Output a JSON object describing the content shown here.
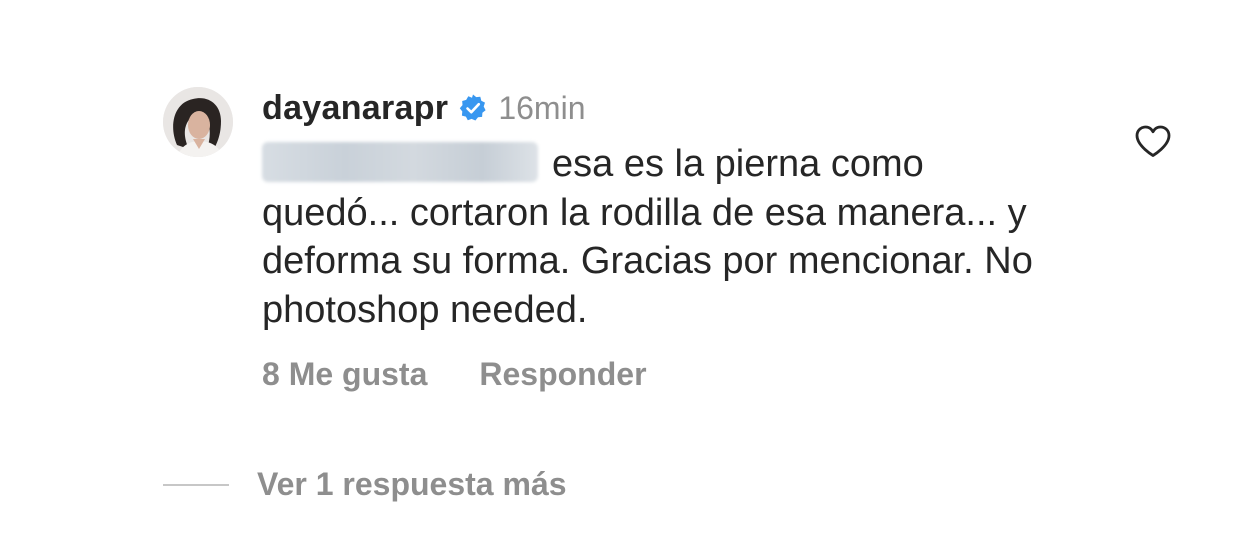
{
  "comment": {
    "username": "dayanarapr",
    "verified_icon": "verified-badge-icon",
    "timestamp": "16min",
    "mention_redacted": true,
    "text": "esa es la pierna como quedó... cortaron la rodilla de esa manera... y deforma su forma. Gracias por mencionar. No photoshop needed.",
    "likes_label": "8 Me gusta",
    "reply_label": "Responder",
    "like_icon": "heart-outline-icon"
  },
  "replies": {
    "view_more_label": "Ver 1 respuesta más"
  },
  "colors": {
    "text_primary": "#262626",
    "text_secondary": "#8e8e8e",
    "verified_blue": "#3897f0",
    "divider": "#c7c7c7"
  }
}
